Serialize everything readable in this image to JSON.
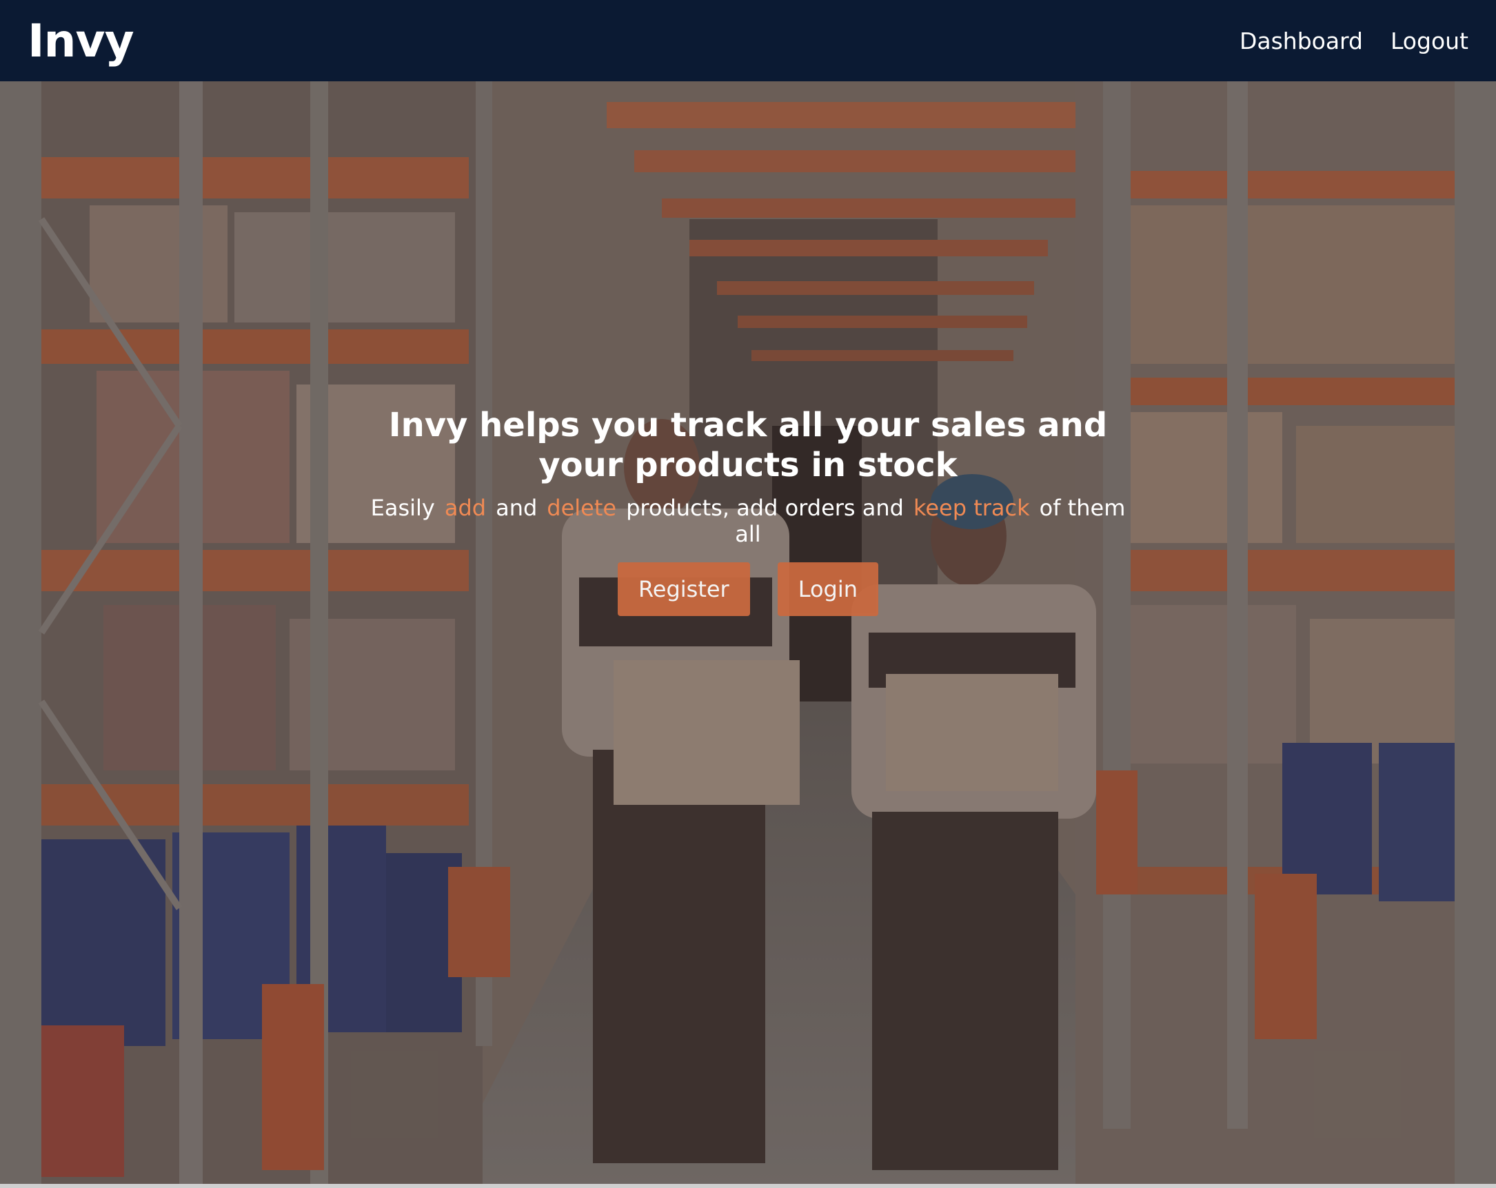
{
  "navbar": {
    "brand": "Invy",
    "links": [
      "Dashboard",
      "Logout"
    ]
  },
  "hero": {
    "title": "Invy helps you track all your sales and your products in stock",
    "subtitle": {
      "part1": "Easily",
      "highlight1": "add",
      "part2": "and",
      "highlight2": "delete",
      "part3": "products, add orders and",
      "highlight3": "keep track",
      "part4": "of them all"
    },
    "buttons": {
      "register": "Register",
      "login": "Login"
    },
    "background_image": "warehouse-workers-carrying-boxes-photo"
  },
  "colors": {
    "navbar_bg": "#0b1a33",
    "accent": "#f08a54",
    "button_bg": "#c9693f",
    "text": "#ffffff"
  }
}
